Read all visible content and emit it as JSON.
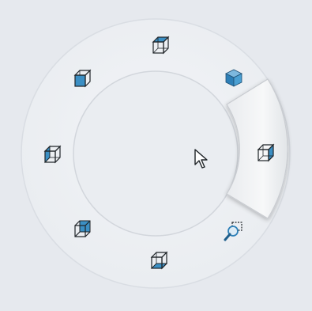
{
  "view_selector": {
    "options": [
      {
        "id": "top",
        "icon": "cube-top-face-icon",
        "highlighted": false
      },
      {
        "id": "isometric",
        "icon": "cube-solid-icon",
        "highlighted": false
      },
      {
        "id": "right",
        "icon": "cube-right-face-icon",
        "highlighted": true
      },
      {
        "id": "zoom-to-selection",
        "icon": "zoom-to-selection-icon",
        "highlighted": false
      },
      {
        "id": "bottom",
        "icon": "cube-bottom-face-icon",
        "highlighted": false
      },
      {
        "id": "back",
        "icon": "cube-back-face-icon",
        "highlighted": false
      },
      {
        "id": "left",
        "icon": "cube-left-face-icon",
        "highlighted": false
      },
      {
        "id": "front",
        "icon": "cube-front-face-icon",
        "highlighted": false
      }
    ],
    "colors": {
      "background": "#e6e9ee",
      "ring": "#edf0f4",
      "ring_edge": "#d4d8de",
      "highlight_segment": "#f3f4f6",
      "face_fill": "#3b8fc4",
      "outline": "#1f2428"
    }
  },
  "cursor": {
    "icon": "mouse-pointer-icon"
  }
}
